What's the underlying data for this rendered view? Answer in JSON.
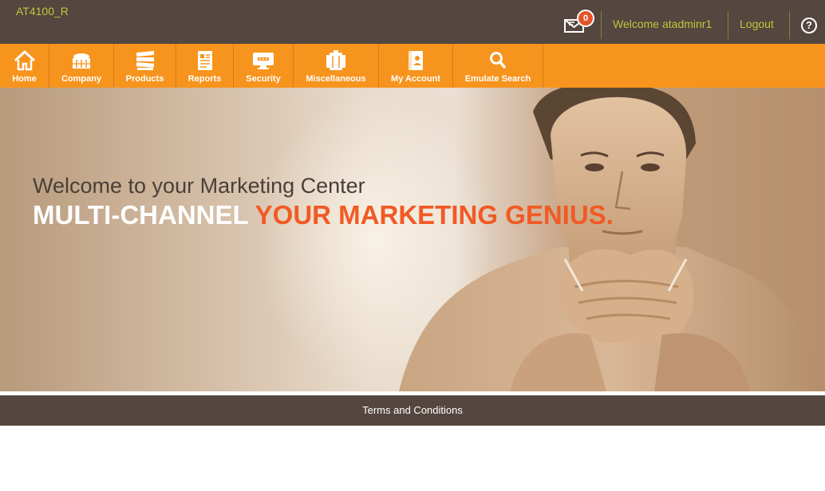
{
  "header": {
    "site_code": "AT4100_R",
    "mail_count": "0",
    "welcome_text": "Welcome atadminr1",
    "logout_label": "Logout",
    "help_label": "?"
  },
  "nav": {
    "items": [
      {
        "label": "Home",
        "icon": "home-icon"
      },
      {
        "label": "Company",
        "icon": "building-icon"
      },
      {
        "label": "Products",
        "icon": "stack-icon"
      },
      {
        "label": "Reports",
        "icon": "report-icon"
      },
      {
        "label": "Security",
        "icon": "security-icon"
      },
      {
        "label": "Miscellaneous",
        "icon": "misc-icon"
      },
      {
        "label": "My Account",
        "icon": "account-icon"
      },
      {
        "label": "Emulate Search",
        "icon": "search-icon"
      }
    ]
  },
  "hero": {
    "line1": "Welcome to your Marketing Center",
    "line2_white": "MULTI-CHANNEL",
    "line2_orange": "YOUR MARKETING GENIUS."
  },
  "footer": {
    "terms_label": "Terms and Conditions"
  },
  "colors": {
    "topbar": "#53473f",
    "nav": "#f7941d",
    "accent_text": "#c6c43b",
    "headline_orange": "#f15a24"
  }
}
